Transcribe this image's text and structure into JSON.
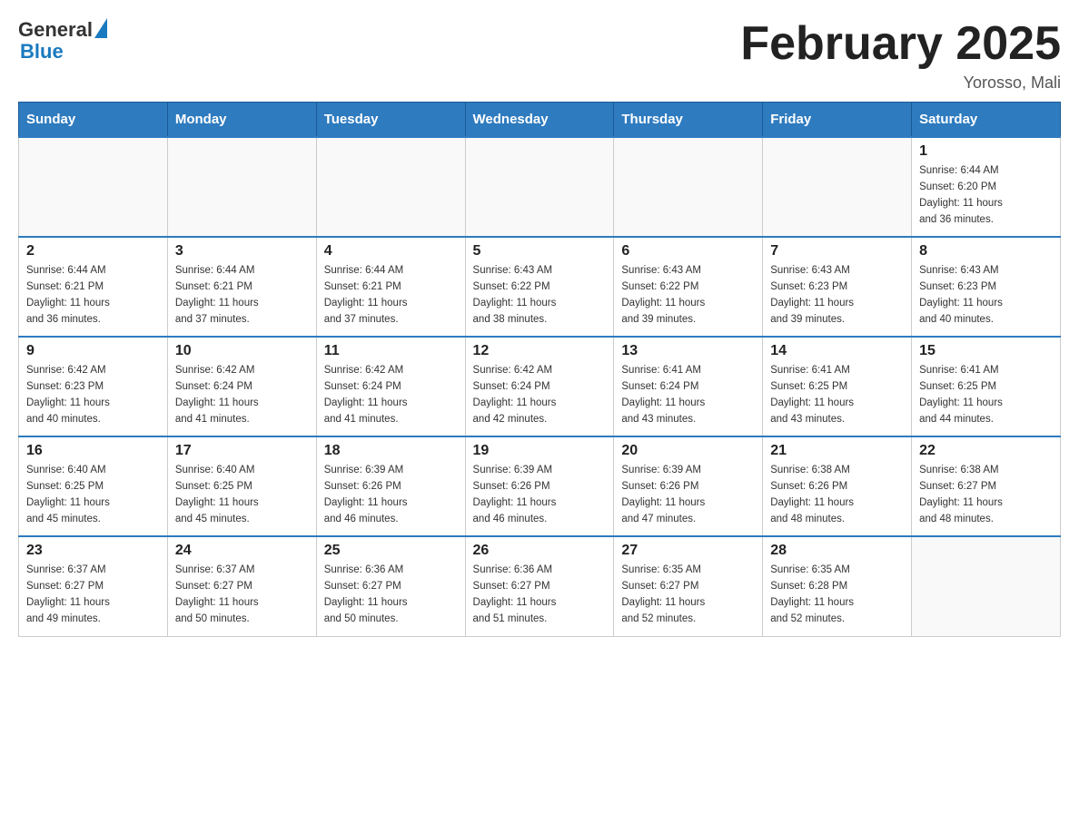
{
  "logo": {
    "general": "General",
    "blue": "Blue"
  },
  "title": {
    "month_year": "February 2025",
    "location": "Yorosso, Mali"
  },
  "weekdays": [
    "Sunday",
    "Monday",
    "Tuesday",
    "Wednesday",
    "Thursday",
    "Friday",
    "Saturday"
  ],
  "weeks": [
    [
      {
        "day": "",
        "info": ""
      },
      {
        "day": "",
        "info": ""
      },
      {
        "day": "",
        "info": ""
      },
      {
        "day": "",
        "info": ""
      },
      {
        "day": "",
        "info": ""
      },
      {
        "day": "",
        "info": ""
      },
      {
        "day": "1",
        "info": "Sunrise: 6:44 AM\nSunset: 6:20 PM\nDaylight: 11 hours\nand 36 minutes."
      }
    ],
    [
      {
        "day": "2",
        "info": "Sunrise: 6:44 AM\nSunset: 6:21 PM\nDaylight: 11 hours\nand 36 minutes."
      },
      {
        "day": "3",
        "info": "Sunrise: 6:44 AM\nSunset: 6:21 PM\nDaylight: 11 hours\nand 37 minutes."
      },
      {
        "day": "4",
        "info": "Sunrise: 6:44 AM\nSunset: 6:21 PM\nDaylight: 11 hours\nand 37 minutes."
      },
      {
        "day": "5",
        "info": "Sunrise: 6:43 AM\nSunset: 6:22 PM\nDaylight: 11 hours\nand 38 minutes."
      },
      {
        "day": "6",
        "info": "Sunrise: 6:43 AM\nSunset: 6:22 PM\nDaylight: 11 hours\nand 39 minutes."
      },
      {
        "day": "7",
        "info": "Sunrise: 6:43 AM\nSunset: 6:23 PM\nDaylight: 11 hours\nand 39 minutes."
      },
      {
        "day": "8",
        "info": "Sunrise: 6:43 AM\nSunset: 6:23 PM\nDaylight: 11 hours\nand 40 minutes."
      }
    ],
    [
      {
        "day": "9",
        "info": "Sunrise: 6:42 AM\nSunset: 6:23 PM\nDaylight: 11 hours\nand 40 minutes."
      },
      {
        "day": "10",
        "info": "Sunrise: 6:42 AM\nSunset: 6:24 PM\nDaylight: 11 hours\nand 41 minutes."
      },
      {
        "day": "11",
        "info": "Sunrise: 6:42 AM\nSunset: 6:24 PM\nDaylight: 11 hours\nand 41 minutes."
      },
      {
        "day": "12",
        "info": "Sunrise: 6:42 AM\nSunset: 6:24 PM\nDaylight: 11 hours\nand 42 minutes."
      },
      {
        "day": "13",
        "info": "Sunrise: 6:41 AM\nSunset: 6:24 PM\nDaylight: 11 hours\nand 43 minutes."
      },
      {
        "day": "14",
        "info": "Sunrise: 6:41 AM\nSunset: 6:25 PM\nDaylight: 11 hours\nand 43 minutes."
      },
      {
        "day": "15",
        "info": "Sunrise: 6:41 AM\nSunset: 6:25 PM\nDaylight: 11 hours\nand 44 minutes."
      }
    ],
    [
      {
        "day": "16",
        "info": "Sunrise: 6:40 AM\nSunset: 6:25 PM\nDaylight: 11 hours\nand 45 minutes."
      },
      {
        "day": "17",
        "info": "Sunrise: 6:40 AM\nSunset: 6:25 PM\nDaylight: 11 hours\nand 45 minutes."
      },
      {
        "day": "18",
        "info": "Sunrise: 6:39 AM\nSunset: 6:26 PM\nDaylight: 11 hours\nand 46 minutes."
      },
      {
        "day": "19",
        "info": "Sunrise: 6:39 AM\nSunset: 6:26 PM\nDaylight: 11 hours\nand 46 minutes."
      },
      {
        "day": "20",
        "info": "Sunrise: 6:39 AM\nSunset: 6:26 PM\nDaylight: 11 hours\nand 47 minutes."
      },
      {
        "day": "21",
        "info": "Sunrise: 6:38 AM\nSunset: 6:26 PM\nDaylight: 11 hours\nand 48 minutes."
      },
      {
        "day": "22",
        "info": "Sunrise: 6:38 AM\nSunset: 6:27 PM\nDaylight: 11 hours\nand 48 minutes."
      }
    ],
    [
      {
        "day": "23",
        "info": "Sunrise: 6:37 AM\nSunset: 6:27 PM\nDaylight: 11 hours\nand 49 minutes."
      },
      {
        "day": "24",
        "info": "Sunrise: 6:37 AM\nSunset: 6:27 PM\nDaylight: 11 hours\nand 50 minutes."
      },
      {
        "day": "25",
        "info": "Sunrise: 6:36 AM\nSunset: 6:27 PM\nDaylight: 11 hours\nand 50 minutes."
      },
      {
        "day": "26",
        "info": "Sunrise: 6:36 AM\nSunset: 6:27 PM\nDaylight: 11 hours\nand 51 minutes."
      },
      {
        "day": "27",
        "info": "Sunrise: 6:35 AM\nSunset: 6:27 PM\nDaylight: 11 hours\nand 52 minutes."
      },
      {
        "day": "28",
        "info": "Sunrise: 6:35 AM\nSunset: 6:28 PM\nDaylight: 11 hours\nand 52 minutes."
      },
      {
        "day": "",
        "info": ""
      }
    ]
  ]
}
